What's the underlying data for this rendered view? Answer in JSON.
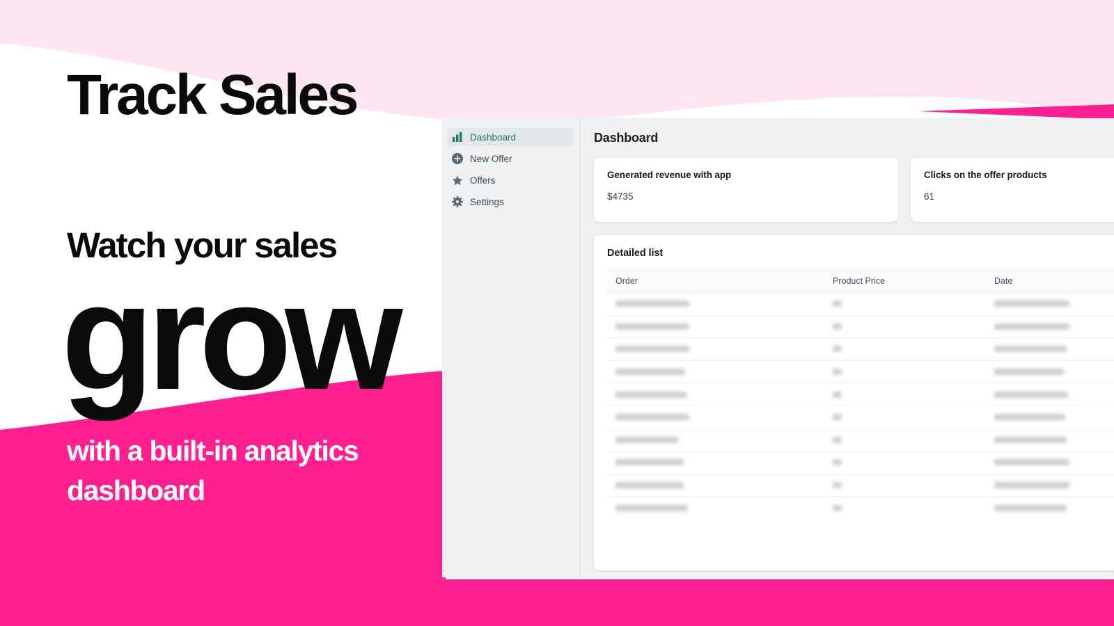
{
  "marketing": {
    "headline": "Track Sales",
    "subhead": "Watch your sales",
    "bigword": "grow",
    "tagline": "with a built-in analytics dashboard",
    "colors": {
      "hot_pink": "#FF1F91",
      "light_pink": "#FDE6F1",
      "white": "#FFFFFF"
    }
  },
  "app": {
    "sidebar": {
      "items": [
        {
          "label": "Dashboard",
          "icon": "bar-chart-icon",
          "active": true
        },
        {
          "label": "New Offer",
          "icon": "plus-circle-icon",
          "active": false
        },
        {
          "label": "Offers",
          "icon": "star-icon",
          "active": false
        },
        {
          "label": "Settings",
          "icon": "gear-icon",
          "active": false
        }
      ],
      "active_color": "#13795B"
    },
    "page_title": "Dashboard",
    "stats": [
      {
        "label": "Generated revenue with app",
        "value": "$4735"
      },
      {
        "label": "Clicks on the offer products",
        "value": "61"
      }
    ],
    "list": {
      "title": "Detailed list",
      "columns": [
        "Order",
        "Product Price",
        "Date"
      ],
      "rows": [
        {
          "order": "",
          "price": "",
          "date": ""
        },
        {
          "order": "",
          "price": "",
          "date": ""
        },
        {
          "order": "",
          "price": "",
          "date": ""
        },
        {
          "order": "",
          "price": "",
          "date": ""
        },
        {
          "order": "",
          "price": "",
          "date": ""
        },
        {
          "order": "",
          "price": "",
          "date": ""
        },
        {
          "order": "",
          "price": "",
          "date": ""
        },
        {
          "order": "",
          "price": "",
          "date": ""
        },
        {
          "order": "",
          "price": "",
          "date": ""
        },
        {
          "order": "",
          "price": "",
          "date": ""
        }
      ],
      "rows_redacted": true
    },
    "pagination": {
      "prev_icon": "chevron-left-icon",
      "next_icon": "chevron-right-icon"
    }
  }
}
